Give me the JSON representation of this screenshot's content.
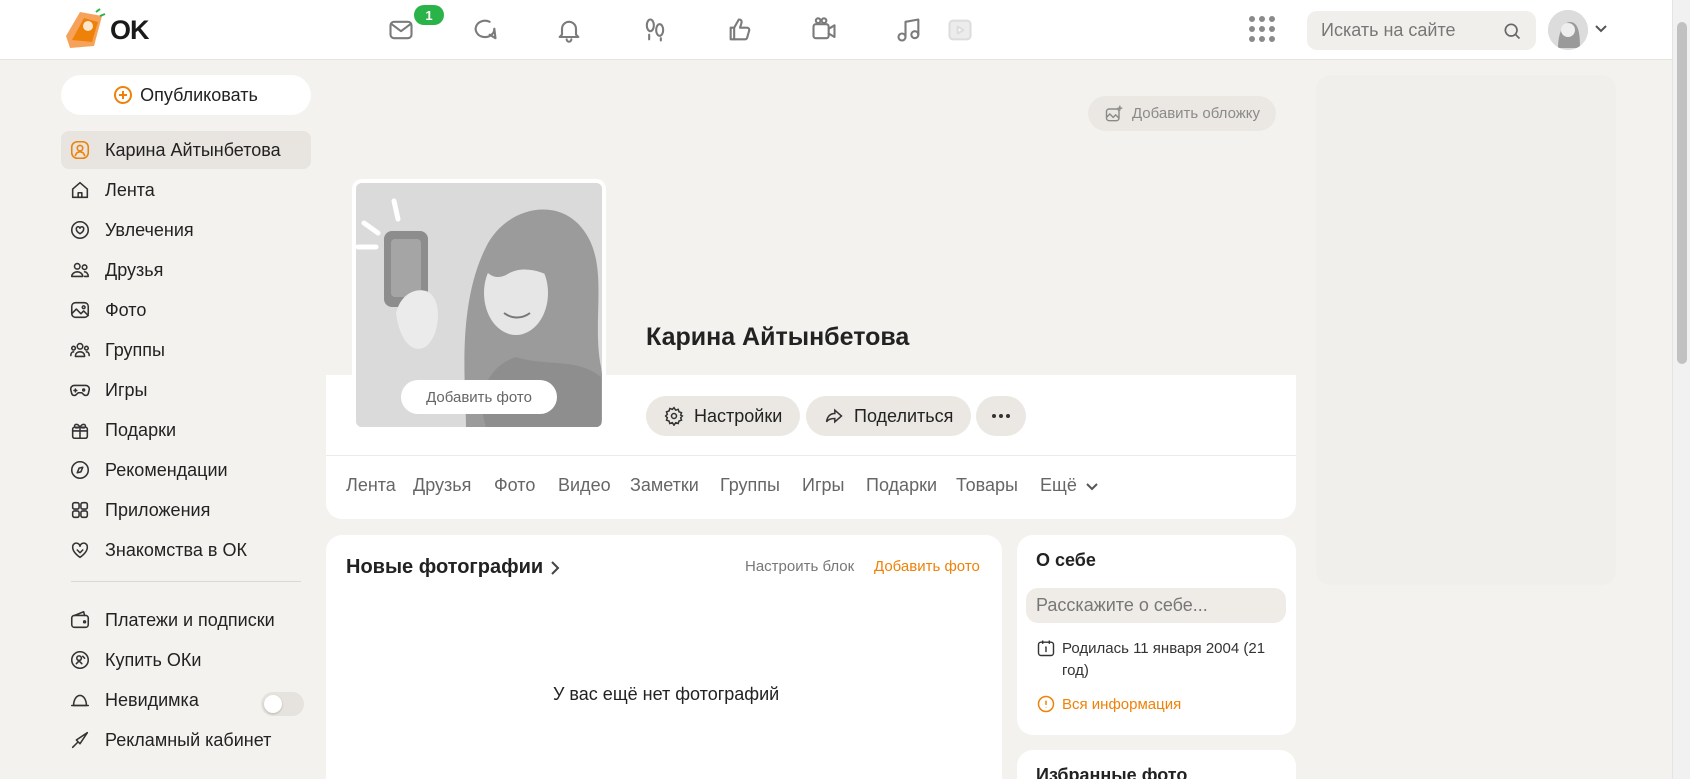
{
  "header": {
    "logo_text": "OK",
    "messages_badge": "1",
    "search_placeholder": "Искать на сайте",
    "nav_icons": [
      "mail-icon",
      "discussions-icon",
      "notifications-icon",
      "guests-icon",
      "likes-icon",
      "video-call-icon",
      "music-icon",
      "video-icon"
    ]
  },
  "sidebar": {
    "publish_label": "Опубликовать",
    "items": [
      {
        "label": "Карина Айтынбетова",
        "icon": "profile-icon",
        "active": true
      },
      {
        "label": "Лента",
        "icon": "home-icon"
      },
      {
        "label": "Увлечения",
        "icon": "hobbies-icon"
      },
      {
        "label": "Друзья",
        "icon": "friends-icon"
      },
      {
        "label": "Фото",
        "icon": "photo-icon"
      },
      {
        "label": "Группы",
        "icon": "groups-icon"
      },
      {
        "label": "Игры",
        "icon": "games-icon"
      },
      {
        "label": "Подарки",
        "icon": "gift-icon"
      },
      {
        "label": "Рекомендации",
        "icon": "compass-icon"
      },
      {
        "label": "Приложения",
        "icon": "apps-icon"
      },
      {
        "label": "Знакомства в ОК",
        "icon": "dating-icon"
      }
    ],
    "secondary_items": [
      {
        "label": "Платежи и подписки",
        "icon": "wallet-icon"
      },
      {
        "label": "Купить ОКи",
        "icon": "coin-icon"
      },
      {
        "label": "Невидимка",
        "icon": "invisible-icon",
        "toggle": false
      },
      {
        "label": "Рекламный кабинет",
        "icon": "ads-icon"
      }
    ]
  },
  "profile": {
    "add_cover_label": "Добавить обложку",
    "add_photo_label": "Добавить фото",
    "name": "Карина Айтынбетова",
    "settings_label": "Настройки",
    "share_label": "Поделиться",
    "tabs": [
      "Лента",
      "Друзья",
      "Фото",
      "Видео",
      "Заметки",
      "Группы",
      "Игры",
      "Подарки",
      "Товары",
      "Ещё"
    ]
  },
  "photos_block": {
    "title": "Новые фотографии",
    "configure_label": "Настроить блок",
    "add_photo_label": "Добавить фото",
    "empty_text": "У вас ещё нет фотографий"
  },
  "about": {
    "title": "О себе",
    "placeholder": "Расскажите о себе...",
    "birth_text": "Родилась 11 января 2004 (21 год)",
    "all_info_label": "Вся информация"
  },
  "favorites": {
    "title": "Избранные фото"
  },
  "colors": {
    "accent": "#ee8208",
    "badge": "#2ab348",
    "background": "#f4f2ef"
  }
}
